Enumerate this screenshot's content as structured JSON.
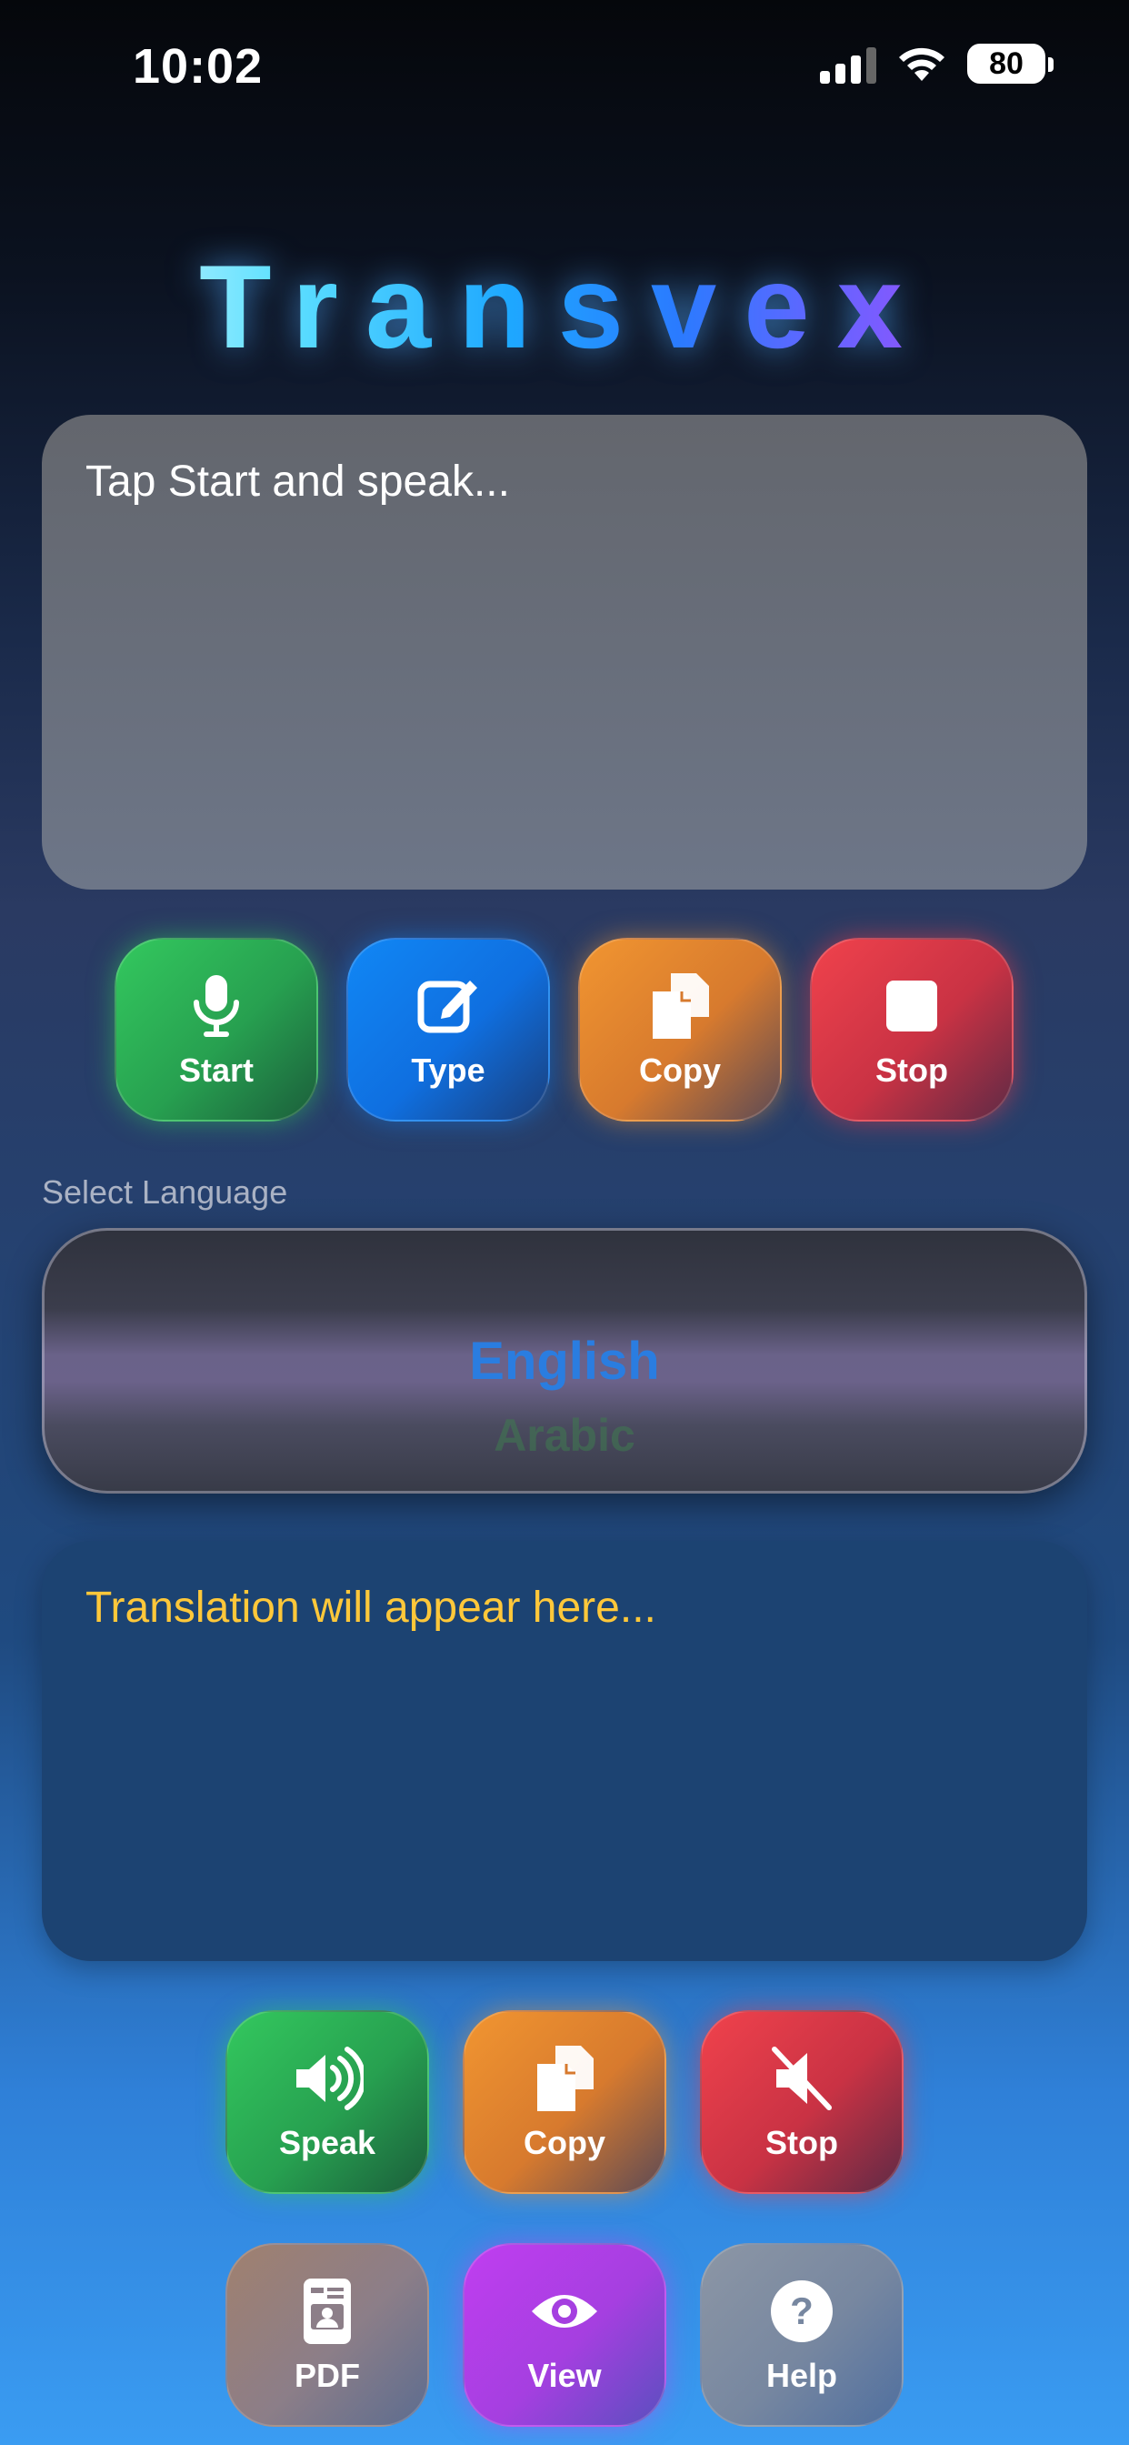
{
  "status_bar": {
    "time": "10:02",
    "battery": "80"
  },
  "app": {
    "title": "Transvex"
  },
  "input": {
    "placeholder": "Tap Start and speak..."
  },
  "input_controls": [
    {
      "label": "Start",
      "icon": "mic-icon"
    },
    {
      "label": "Type",
      "icon": "edit-icon"
    },
    {
      "label": "Copy",
      "icon": "copy-icon"
    },
    {
      "label": "Stop",
      "icon": "stop-icon"
    }
  ],
  "language": {
    "label": "Select Language",
    "options": [
      "English",
      "Arabic"
    ],
    "selected": "English"
  },
  "output": {
    "placeholder": "Translation will appear here..."
  },
  "output_controls": [
    {
      "label": "Speak",
      "icon": "speaker-icon"
    },
    {
      "label": "Copy",
      "icon": "copy-icon"
    },
    {
      "label": "Stop",
      "icon": "mute-icon"
    }
  ],
  "extra_controls": [
    {
      "label": "PDF",
      "icon": "pdf-icon"
    },
    {
      "label": "View",
      "icon": "eye-icon"
    },
    {
      "label": "Help",
      "icon": "help-icon"
    }
  ],
  "colors": {
    "start": "#33c85e",
    "type": "#1187f5",
    "copy": "#f19530",
    "stop": "#f0424c",
    "view": "#c03ef0",
    "translation_text": "#ffc83a",
    "selected_language": "#2a7de0"
  }
}
